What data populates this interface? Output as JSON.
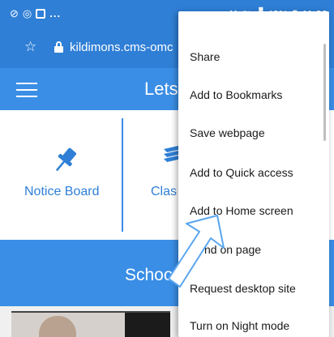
{
  "status_bar": {
    "left_icons": [
      "cast-icon",
      "circle-icon",
      "app-icon"
    ],
    "overflow": "...",
    "right_icons": [
      "mute-icon",
      "wifi-icon",
      "signal-icon"
    ],
    "battery": "42%",
    "time": "11:39"
  },
  "browser": {
    "url": "kildimons.cms-omc"
  },
  "app": {
    "title": "Lets"
  },
  "grid": {
    "item1_label": "Notice Board",
    "item2_label": "Clas"
  },
  "band": {
    "title": "Schoo"
  },
  "menu": {
    "items": [
      {
        "label": "Share"
      },
      {
        "label": "Add to Bookmarks"
      },
      {
        "label": "Save webpage"
      },
      {
        "label": "Add to Quick access"
      },
      {
        "label": "Add to Home screen"
      },
      {
        "label": "nd on page"
      },
      {
        "label": "Request desktop site"
      },
      {
        "label": "Turn on Night mode"
      }
    ]
  },
  "colors": {
    "status_bar": "#2f7fd6",
    "app_bar": "#3a8ee6",
    "accent": "#3a8ee6",
    "menu_bg": "#ffffff",
    "arrow": "#5aa6f0"
  }
}
